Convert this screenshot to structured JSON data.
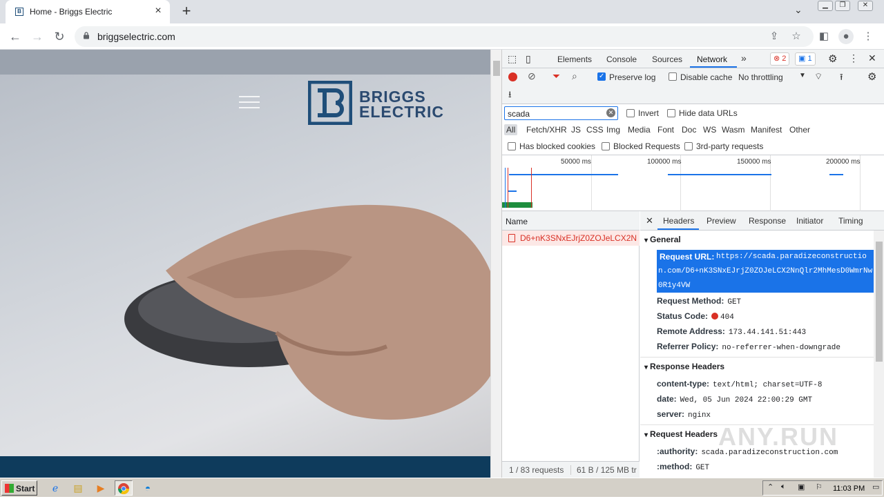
{
  "browser": {
    "tab_title": "Home - Briggs Electric",
    "url": "briggselectric.com",
    "new_tab_label": "+"
  },
  "page": {
    "logo_line1": "BRIGGS",
    "logo_line2": "ELECTRIC"
  },
  "devtools": {
    "tabs": [
      "Elements",
      "Console",
      "Sources",
      "Network"
    ],
    "active_tab": "Network",
    "error_count": "2",
    "message_count": "1",
    "preserve_log": "Preserve log",
    "disable_cache": "Disable cache",
    "throttling": "No throttling",
    "filter_value": "scada",
    "invert": "Invert",
    "hide_data_urls": "Hide data URLs",
    "type_filters": [
      "All",
      "Fetch/XHR",
      "JS",
      "CSS",
      "Img",
      "Media",
      "Font",
      "Doc",
      "WS",
      "Wasm",
      "Manifest",
      "Other"
    ],
    "has_blocked_cookies": "Has blocked cookies",
    "blocked_requests": "Blocked Requests",
    "third_party": "3rd-party requests",
    "timeline_labels": [
      "50000 ms",
      "100000 ms",
      "150000 ms",
      "200000 ms"
    ],
    "name_header": "Name",
    "request_name": "D6+nK3SNxEJrjZ0ZOJeLCX2N...",
    "status_requests": "1 / 83 requests",
    "status_transfer": "61 B / 125 MB tr",
    "detail_tabs": [
      "Headers",
      "Preview",
      "Response",
      "Initiator",
      "Timing"
    ],
    "general": {
      "title": "General",
      "request_url_key": "Request URL:",
      "request_url": "https://scada.paradizeconstruction.com/D6+nK3SNxEJrjZ0ZOJeLCX2NnQlr2MhMesD0WmrNw0R1y4VW",
      "method_key": "Request Method:",
      "method": "GET",
      "status_key": "Status Code:",
      "status": "404",
      "remote_key": "Remote Address:",
      "remote": "173.44.141.51:443",
      "referrer_key": "Referrer Policy:",
      "referrer": "no-referrer-when-downgrade"
    },
    "response_headers": {
      "title": "Response Headers",
      "content_type_key": "content-type:",
      "content_type": "text/html; charset=UTF-8",
      "date_key": "date:",
      "date": "Wed, 05 Jun 2024 22:00:29 GMT",
      "server_key": "server:",
      "server": "nginx"
    },
    "request_headers": {
      "title": "Request Headers",
      "authority_key": ":authority:",
      "authority": "scada.paradizeconstruction.com",
      "method_key": ":method:",
      "method": "GET"
    },
    "status_dot_color": "#d93025"
  },
  "watermark": "ANY.RUN",
  "taskbar": {
    "start": "Start",
    "clock": "11:03 PM"
  }
}
